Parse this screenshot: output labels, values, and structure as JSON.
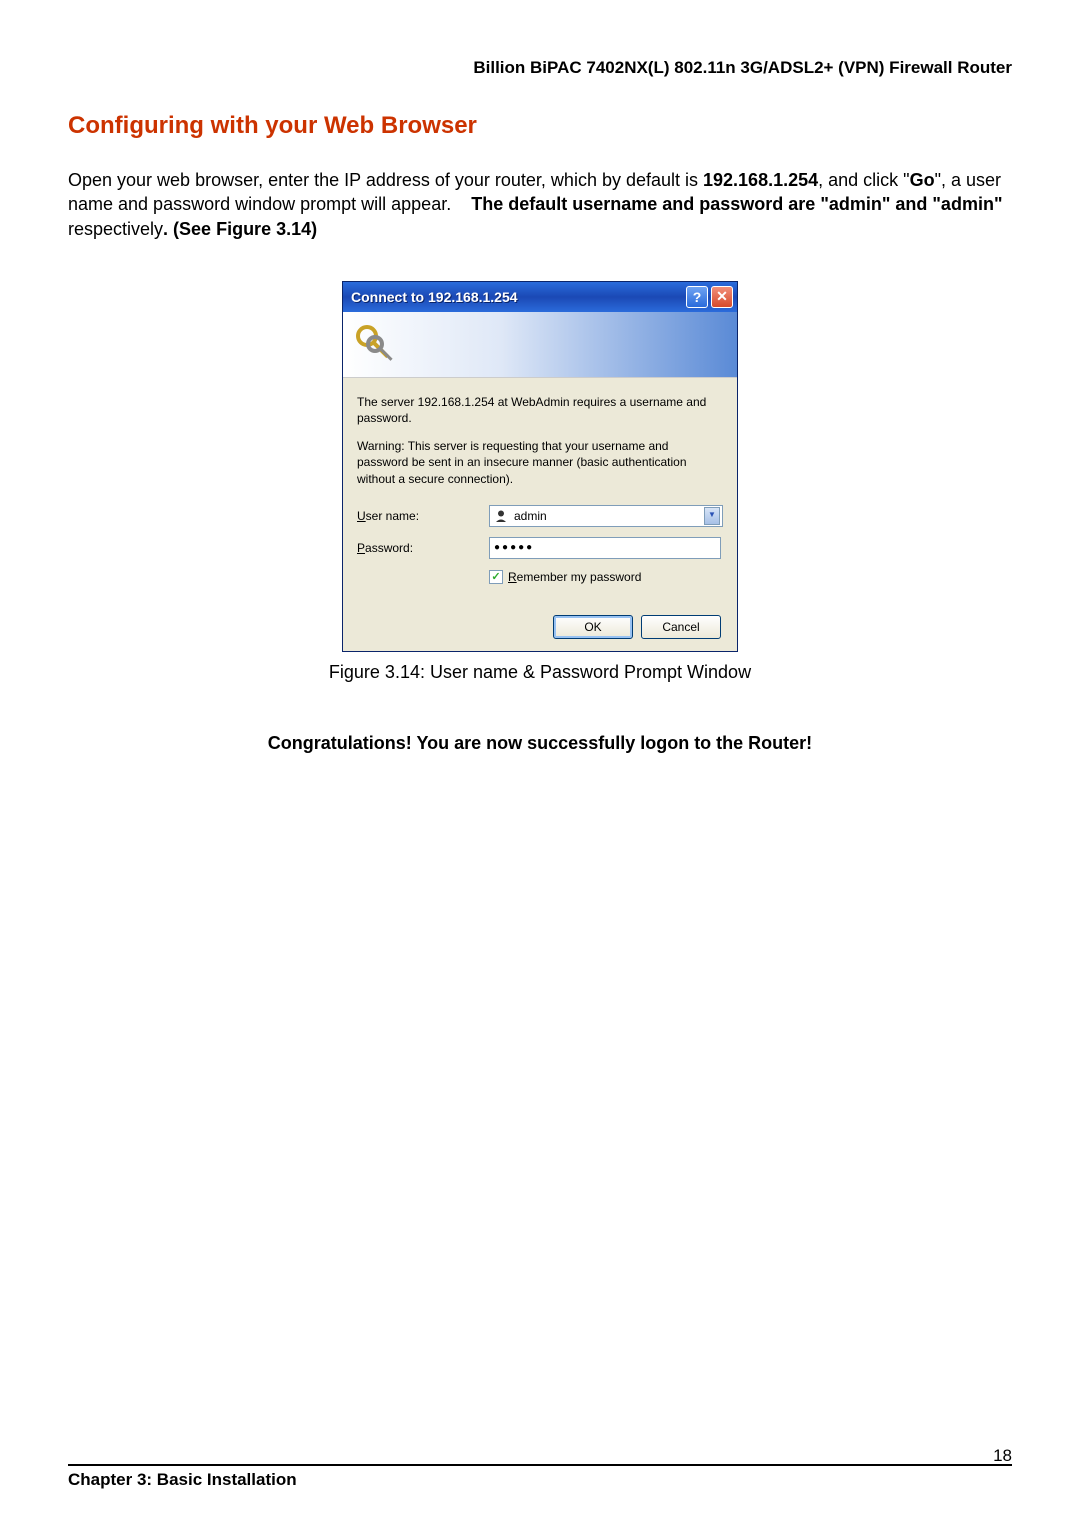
{
  "header": {
    "product": "Billion BiPAC 7402NX(L) 802.11n 3G/ADSL2+ (VPN) Firewall Router"
  },
  "section": {
    "title": "Configuring with your Web Browser"
  },
  "paragraph": {
    "p1a": "Open your web browser, enter the IP address of your router, which by default is ",
    "ip": "192.168.1.254",
    "p1b": ", and click \"",
    "go": "Go",
    "p1c": "\", a user name and password window prompt will appear.    ",
    "bold2": "The default username and password are \"admin\" and \"admin\" ",
    "p1d": "respectively",
    "bold3": ". (See Figure 3.14)"
  },
  "dialog": {
    "title": "Connect to 192.168.1.254",
    "msg1": "The server 192.168.1.254 at WebAdmin requires a username and password.",
    "msg2": "Warning: This server is requesting that your username and password be sent in an insecure manner (basic authentication without a secure connection).",
    "username_label_u": "U",
    "username_label_rest": "ser name:",
    "username_value": "admin",
    "password_label_p": "P",
    "password_label_rest": "assword:",
    "password_mask": "●●●●●",
    "remember_r": "R",
    "remember_rest": "emember my password",
    "ok": "OK",
    "cancel": "Cancel"
  },
  "caption": "Figure 3.14: User name & Password Prompt Window",
  "congrats": "Congratulations! You are now successfully logon to the Router!",
  "footer": {
    "chapter": "Chapter 3: Basic Installation",
    "page": "18"
  }
}
